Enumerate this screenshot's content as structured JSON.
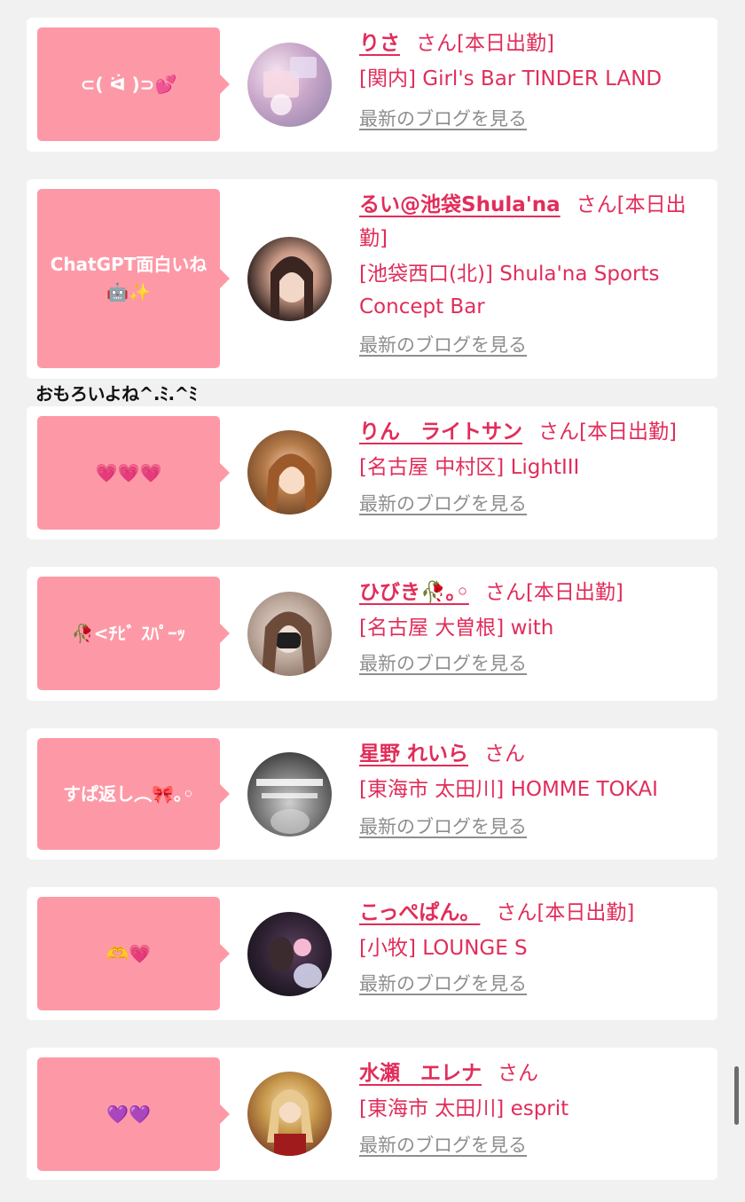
{
  "blog_link_label": "最新のブログを見る",
  "suffix": "さん",
  "stray_text": "おもろいよね^.ﾐ.^ﾐ",
  "colors": {
    "bubble": "#fd99a7",
    "accent": "#e12d5a",
    "link_gray": "#8e8e8e",
    "background": "#f1f1f1"
  },
  "cards": [
    {
      "message": "⊂( ᐛ )⊃💕",
      "name": "りさ",
      "status": "[本日出勤]",
      "shop": "[関内] Girl's Bar TINDER LAND",
      "avatar": "avatar-photo"
    },
    {
      "message": "ChatGPT面白いね\n🤖✨",
      "name": "るい@池袋Shula'na",
      "status": "[本日出勤]",
      "shop": "[池袋西口(北)] Shula'na Sports Concept Bar",
      "avatar": "avatar-photo"
    },
    {
      "message": "💗💗💗",
      "name": "りん　ライトサン",
      "status": "[本日出勤]",
      "shop": "[名古屋 中村区] LightIII",
      "avatar": "avatar-photo"
    },
    {
      "message": "🥀<ﾁﾋﾞ ｽﾊﾟｰｯ",
      "name": "ひびき🥀｡◦",
      "status": "[本日出勤]",
      "shop": "[名古屋 大曽根] with",
      "avatar": "avatar-photo"
    },
    {
      "message": "すぱ返し︵🎀｡◦",
      "name": "星野 れいら",
      "status": "",
      "shop": "[東海市 太田川] HOMME TOKAI",
      "avatar": "avatar-photo"
    },
    {
      "message": "🫶💗",
      "name": "こっぺぱん。",
      "status": "[本日出勤]",
      "shop": "[小牧] LOUNGE S",
      "avatar": "avatar-photo"
    },
    {
      "message": "💜💜",
      "name": "水瀬　エレナ",
      "status": "",
      "shop": "[東海市 太田川] esprit",
      "avatar": "avatar-photo"
    }
  ]
}
